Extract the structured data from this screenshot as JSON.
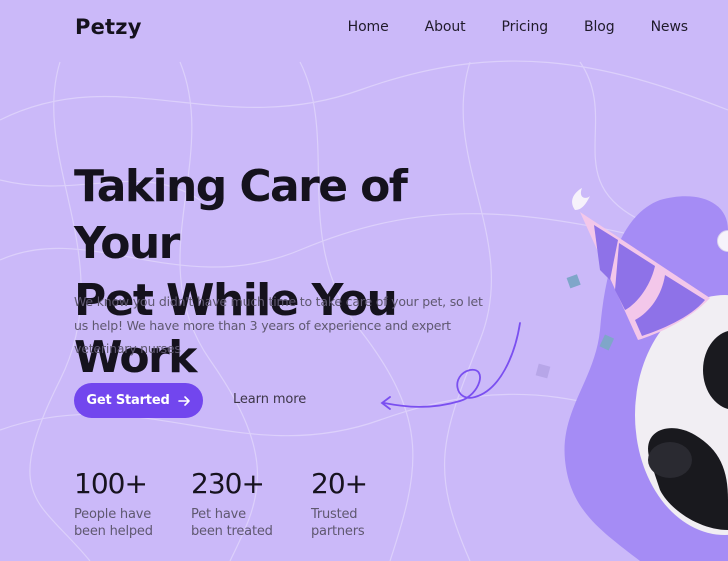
{
  "brand": {
    "name": "Petzy"
  },
  "nav": {
    "items": [
      {
        "label": "Home"
      },
      {
        "label": "About"
      },
      {
        "label": "Pricing"
      },
      {
        "label": "Blog"
      },
      {
        "label": "News"
      }
    ]
  },
  "hero": {
    "title_line1": "Taking Care of Your",
    "title_line2": "Pet While You Work",
    "description": "We know you didn't have much time to take care of your pet, so let us help! We have more than 3 years of experience and expert veterinary nurses",
    "cta_primary": "Get Started",
    "cta_primary_icon": "arrow-right-icon",
    "cta_secondary": "Learn more"
  },
  "stats": [
    {
      "value": "100+",
      "label_line1": "People have",
      "label_line2": "been helped"
    },
    {
      "value": "230+",
      "label_line1": "Pet have",
      "label_line2": "been treated"
    },
    {
      "value": "20+",
      "label_line1": "Trusted",
      "label_line2": "partners"
    }
  ],
  "colors": {
    "background": "#cbb9f9",
    "accent": "#7246ee",
    "blob": "#a58cf5",
    "heading": "#15121d",
    "body_text": "#5f5870"
  }
}
